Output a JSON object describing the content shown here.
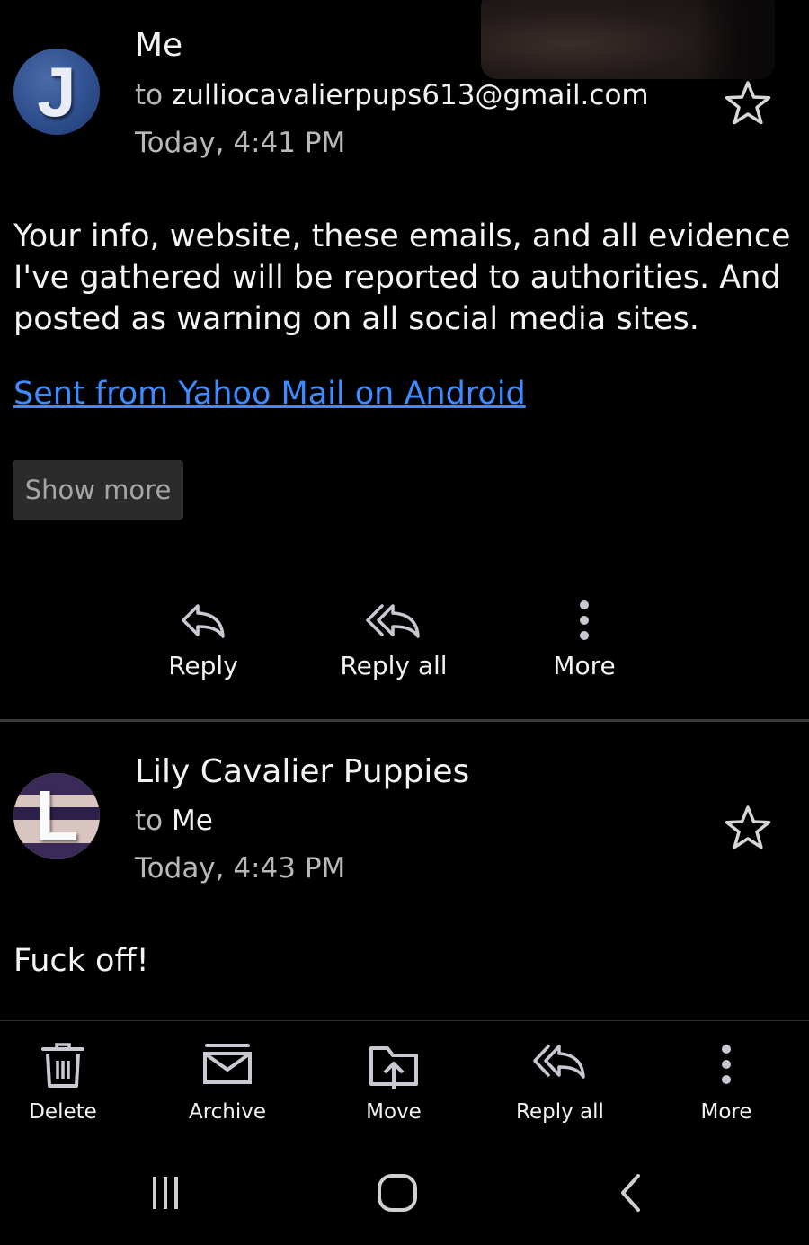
{
  "message1": {
    "avatar_letter": "J",
    "sender": "Me",
    "to_prefix": "to",
    "to_address": "zulliocavalierpups613@gmail.com",
    "date": "Today, 4:41 PM",
    "body": "Your info, website, these emails, and all evidence I've gathered will be reported to authorities. And posted as warning on all social media sites.",
    "signature_link": "Sent from Yahoo Mail on Android",
    "show_more_label": "Show more",
    "actions": {
      "reply_label": "Reply",
      "reply_all_label": "Reply all",
      "more_label": "More"
    }
  },
  "message2": {
    "avatar_letter": "L",
    "sender": "Lily Cavalier Puppies",
    "to_prefix": "to",
    "to_address": "Me",
    "date": "Today, 4:43 PM",
    "body": "Fuck off!"
  },
  "toolbar": {
    "delete_label": "Delete",
    "archive_label": "Archive",
    "move_label": "Move",
    "reply_all_label": "Reply all",
    "more_label": "More"
  },
  "colors": {
    "background": "#000000",
    "link": "#3d8bff",
    "secondary_text": "#b8b8b8",
    "divider": "#3a3a3a"
  },
  "icons": {
    "star": "star-outline-icon",
    "reply": "reply-arrow-icon",
    "reply_all": "reply-all-arrow-icon",
    "more": "vertical-dots-icon",
    "delete": "trash-icon",
    "archive": "archive-box-icon",
    "move": "move-upload-icon",
    "nav_recents": "recents-lines-icon",
    "nav_home": "home-rounded-square-icon",
    "nav_back": "back-chevron-icon"
  }
}
